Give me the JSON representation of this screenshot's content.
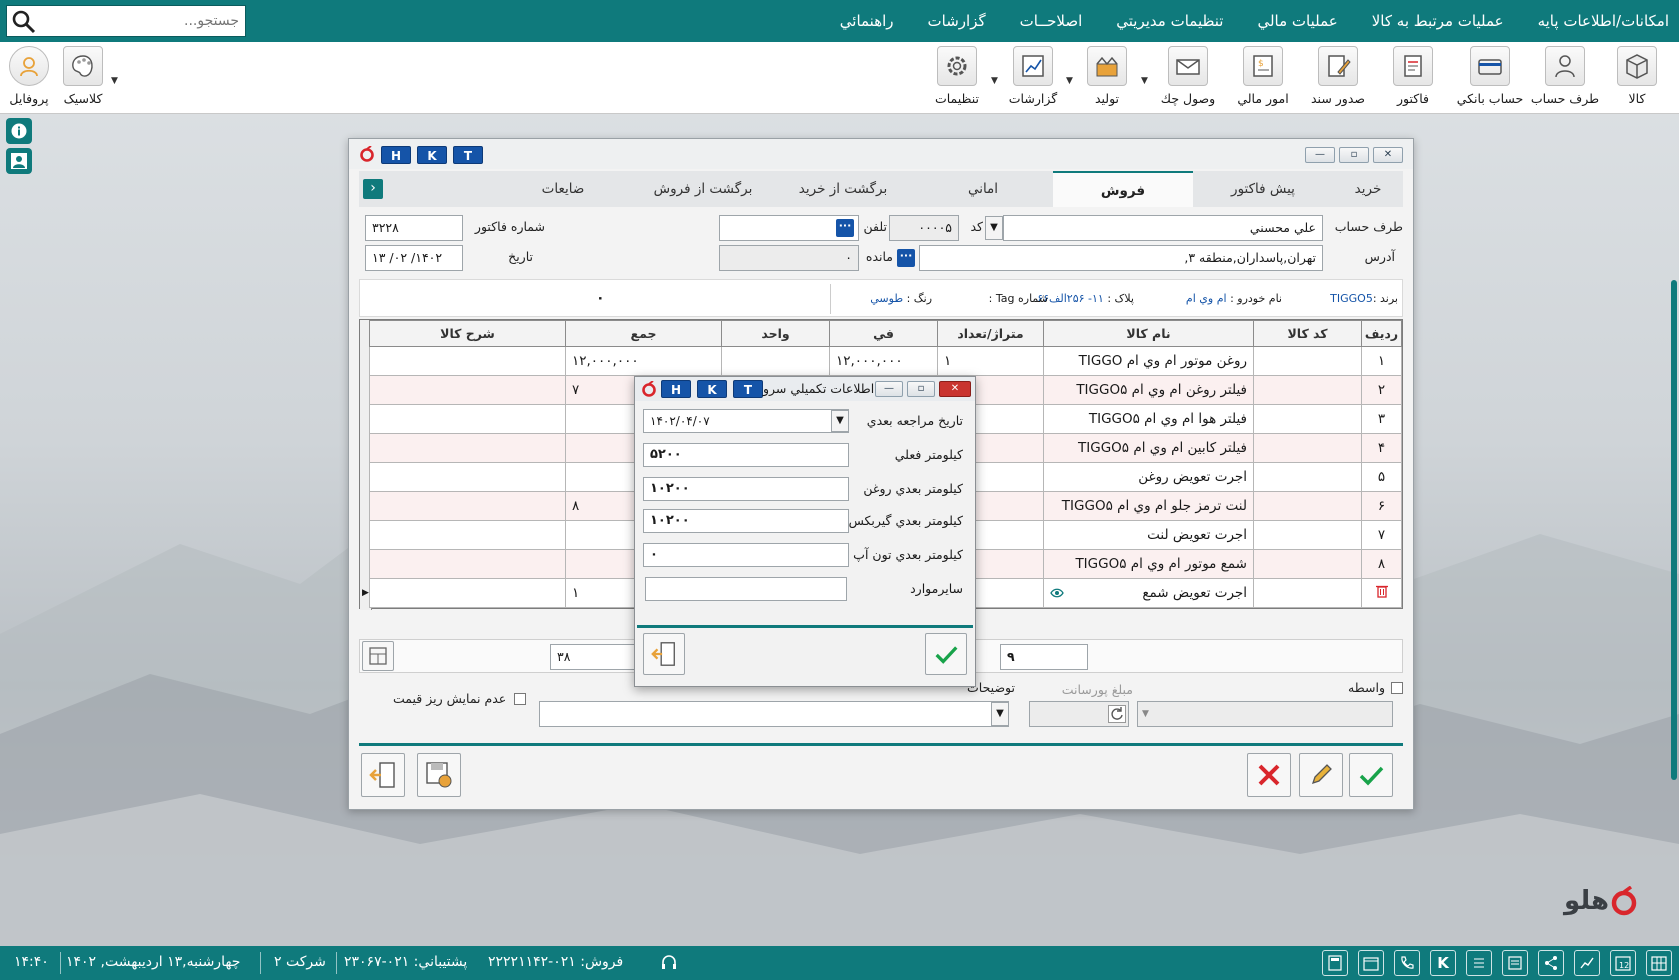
{
  "menu": [
    "امکانات/اطلاعات پايه",
    "عمليات مرتبط به کالا",
    "عمليات مالي",
    "تنظيمات مديريتي",
    "اصلاحــات",
    "گزارشات",
    "راهنمائي"
  ],
  "search": {
    "placeholder": "جستجو..."
  },
  "toolbar": {
    "kala": "کالا",
    "taraf_hesab": "طرف حساب",
    "hesab_banki": "حساب بانکي",
    "factor": "فاکتور",
    "sodoor_sanad": "صدور سند",
    "omoor_mali": "امور مالي",
    "vosool_chek": "وصول چك",
    "tolid": "توليد",
    "gozareshat": "گزارشات",
    "tanzimat": "تنظيمات",
    "classic": "کلاسيک",
    "profile": "پروفايل"
  },
  "window": {
    "btn_h": "H",
    "btn_k": "K",
    "btn_t": "T"
  },
  "tabs": [
    "خريد",
    "پيش فاکتور",
    "فروش",
    "اماني",
    "برگشت از خريد",
    "برگشت از فروش",
    "ضايعات"
  ],
  "form": {
    "taraf_label": "طرف حساب",
    "taraf_value": "علي محسني",
    "code_label": "کد",
    "code_value": "۰۰۰۰۵",
    "phone_label": "تلفن",
    "phone_value": "",
    "factor_no_label": "شماره فاکتور",
    "factor_no_value": "۳۲۲۸",
    "address_label": "آدرس",
    "address_value": "تهران,پاسداران,منطقه ۳,",
    "mande_label": "مانده",
    "mande_value": "۰",
    "date_label": "تاريخ",
    "date_value": "۱۴۰۲/ ۰۲/ ۱۳"
  },
  "vehicle": {
    "brand_label": "برند :",
    "brand_value": "TIGGO5",
    "model_label": "نام خودرو :",
    "model_value": "ام وي ام",
    "plate_label": "پلاک :",
    "plate_value": "۱۱- ۲۵۶الف۶۶",
    "tag_label": "شماره Tag :",
    "tag_value": "",
    "color_label": "رنگ :",
    "color_value": "طوسي",
    "zero": "۰"
  },
  "grid": {
    "headers": [
      "رديف",
      "کد کالا",
      "نام کالا",
      "متراژ/تعداد",
      "في",
      "واحد",
      "جمع",
      "شرح کالا"
    ],
    "rows": [
      {
        "n": "۱",
        "name": "روغن موتور ام وي ام TIGGO",
        "qty": "۱",
        "price": "۱۲,۰۰۰,۰۰۰",
        "total": "۱۲,۰۰۰,۰۰۰"
      },
      {
        "n": "۲",
        "name": "فيلتر روغن ام وي ام TIGGO۵",
        "qty": "۱",
        "price": "",
        "total": "۷"
      },
      {
        "n": "۳",
        "name": "فيلتر هوا ام وي ام TIGGO۵",
        "qty": "۱",
        "price": "",
        "total": ""
      },
      {
        "n": "۴",
        "name": "فيلتر کابين ام وي ام TIGGO۵",
        "qty": "۱",
        "price": "",
        "total": ""
      },
      {
        "n": "۵",
        "name": "اجرت تعويض روغن",
        "qty": "۱",
        "price": "",
        "total": ""
      },
      {
        "n": "۶",
        "name": "لنت ترمز جلو ام وي ام TIGGO۵",
        "qty": "۱",
        "price": "",
        "total": "۸"
      },
      {
        "n": "۷",
        "name": "اجرت تعويض لنت",
        "qty": "۱",
        "price": "",
        "total": ""
      },
      {
        "n": "۸",
        "name": "شمع موتور ام وي ام TIGGO۵",
        "qty": "۱",
        "price": "",
        "total": ""
      },
      {
        "n": "",
        "name": "اجرت تعويض شمع",
        "qty": "۱",
        "price": "",
        "total": "۱"
      }
    ]
  },
  "summary": {
    "count": "۹",
    "sum_partial": "۳۸"
  },
  "bottom": {
    "no_price_detail": "عدم نمايش ريز قيمت",
    "tozihat": "توضيحات",
    "tozihat_value": "+",
    "porsant": "مبلغ پورسانت",
    "vaseteh": "واسطه"
  },
  "dialog": {
    "title": "اطلاعات تكميلي سرو",
    "next_visit_label": "تاريخ مراجعه بعدي",
    "next_visit_value": "۱۴۰۲/۰۴/۰۷",
    "km_now_label": "كيلومتر فعلي",
    "km_now_value": "۵۲۰۰",
    "km_oil_label": "كيلومتر بعدي روغن",
    "km_oil_value": "۱۰۲۰۰",
    "km_gear_label": "كيلومتر بعدي گيربكس",
    "km_gear_value": "۱۰۲۰۰",
    "km_tuneup_label": "كيلومتر بعدي تون آپ",
    "km_tuneup_value": "۰",
    "other_label": "سايرموارد",
    "other_value": ""
  },
  "status": {
    "time": "۱۴:۴۰",
    "date": "چهارشنبه,۱۳ ارديبهشت, ۱۴۰۲",
    "company": "شرکت ۲",
    "support": "پشتيباني: ۰۲۱-۲۳۰۶۷",
    "sales": "فروش: ۰۲۱-۲۲۲۲۱۱۴۲"
  },
  "brand_name": "هلو",
  "colors": {
    "teal": "#0f7a7c",
    "blue": "#1554a8",
    "red": "#d9262c",
    "green": "#18a34a"
  }
}
